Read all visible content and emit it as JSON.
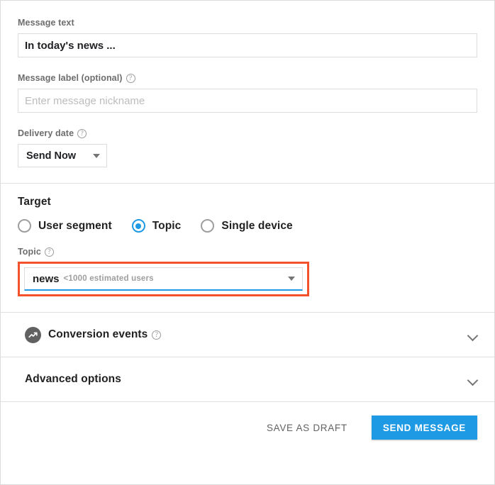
{
  "form": {
    "message_text": {
      "label": "Message text",
      "value": "In today's news ..."
    },
    "message_label": {
      "label": "Message label (optional)",
      "placeholder": "Enter message nickname",
      "value": ""
    },
    "delivery_date": {
      "label": "Delivery date",
      "selected": "Send Now"
    }
  },
  "target": {
    "title": "Target",
    "options": [
      {
        "label": "User segment",
        "selected": false
      },
      {
        "label": "Topic",
        "selected": true
      },
      {
        "label": "Single device",
        "selected": false
      }
    ],
    "topic_field": {
      "label": "Topic",
      "value": "news",
      "estimate": "<1000 estimated users",
      "highlight_color": "#f4512c",
      "underline_color": "#1e9ae4"
    }
  },
  "sections": [
    {
      "title": "Conversion events",
      "icon": "trending-up-icon",
      "has_help": true,
      "expanded": false
    },
    {
      "title": "Advanced options",
      "icon": "",
      "has_help": false,
      "expanded": false
    }
  ],
  "footer": {
    "save_draft_label": "SAVE AS DRAFT",
    "send_label": "SEND MESSAGE",
    "accent_color": "#1e9ae4"
  },
  "icons": {
    "help": "?",
    "chevron_down": "chevron-down-icon",
    "caret_down": "caret-down-icon"
  }
}
